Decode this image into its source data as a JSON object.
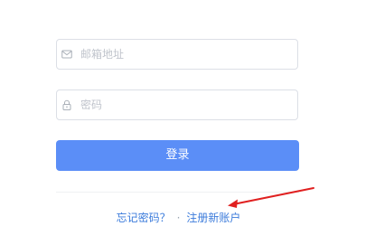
{
  "form": {
    "email": {
      "placeholder": "邮箱地址",
      "value": "",
      "icon": "mail-icon"
    },
    "password": {
      "placeholder": "密码",
      "value": "",
      "icon": "lock-icon"
    },
    "login_label": "登录"
  },
  "links": {
    "forgot_password": "忘记密码？",
    "separator": "·",
    "register": "注册新账户"
  },
  "colors": {
    "primary": "#5b8ef7",
    "link": "#3b7bdb",
    "annotation_arrow": "#e02020"
  }
}
